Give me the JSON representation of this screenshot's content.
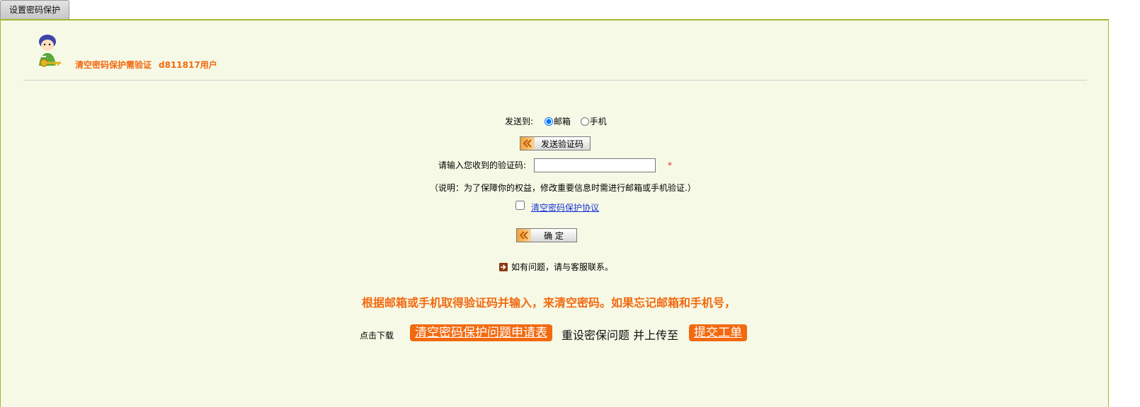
{
  "tab": {
    "label": "设置密码保护"
  },
  "header": {
    "title": "清空密码保护需验证",
    "user": "d811817用户"
  },
  "send": {
    "label": "发送到:",
    "options": [
      "邮箱",
      "手机"
    ],
    "selected": "邮箱",
    "button": "发送验证码"
  },
  "code": {
    "label": "请输入您收到的验证码:",
    "value": "",
    "required_mark": "*"
  },
  "note": "（说明：为了保障你的权益，修改重要信息时需进行邮箱或手机验证.）",
  "agreement": {
    "checked": false,
    "link": "清空密码保护协议"
  },
  "confirm": {
    "label": "确 定"
  },
  "help": "如有问题，请与客服联系。",
  "instructions": "根据邮箱或手机取得验证码并输入，来清空密码。如果忘记邮箱和手机号，",
  "download": {
    "prefix": "点击下载",
    "form_link": "清空密码保护问题申请表",
    "middle": "重设密保问题 并上传至",
    "ticket_link": "提交工单"
  },
  "colors": {
    "accent": "#f26a10",
    "panel_bg": "#f6f9e6",
    "panel_border": "#9fba2e",
    "link": "#1a34d8"
  }
}
